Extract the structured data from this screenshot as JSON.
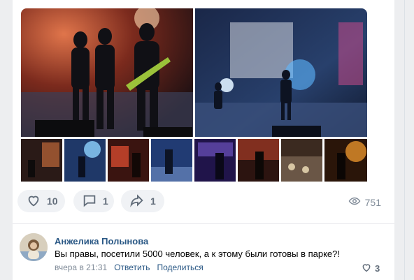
{
  "post": {
    "photos": {
      "big": [
        {
          "name": "concert-photo-band-guitarists"
        },
        {
          "name": "concert-photo-stage-lights"
        }
      ],
      "thumbs": [
        {
          "name": "thumb-1"
        },
        {
          "name": "thumb-2"
        },
        {
          "name": "thumb-3"
        },
        {
          "name": "thumb-4"
        },
        {
          "name": "thumb-5"
        },
        {
          "name": "thumb-6"
        },
        {
          "name": "thumb-7"
        },
        {
          "name": "thumb-8"
        }
      ]
    },
    "actions": {
      "likes": "10",
      "comments": "1",
      "shares": "1",
      "views": "751"
    }
  },
  "comment": {
    "author": "Анжелика Полынова",
    "text": "Вы правы, посетили 5000 человек, а к этому были готовы в парке?!",
    "time": "вчера в 21:31",
    "reply_label": "Ответить",
    "share_label": "Поделиться",
    "likes": "3"
  },
  "colors": {
    "link": "#2a5885",
    "icon": "#626d7a",
    "pill_bg": "#f0f2f5"
  }
}
